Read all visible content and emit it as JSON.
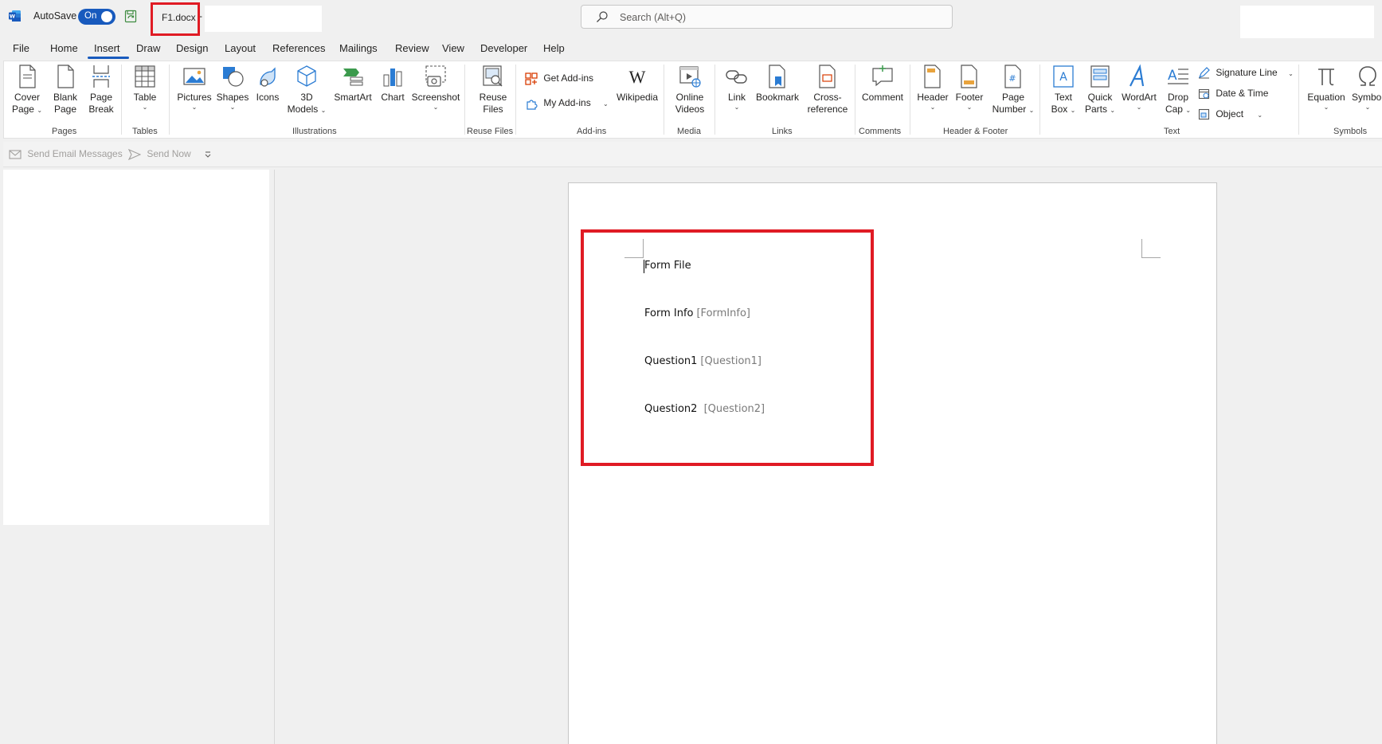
{
  "titlebar": {
    "autosave_label": "AutoSave",
    "autosave_state": "On",
    "filename": "F1.docx",
    "separator": "-",
    "search_placeholder": "Search (Alt+Q)"
  },
  "tabs": [
    "File",
    "Home",
    "Insert",
    "Draw",
    "Design",
    "Layout",
    "References",
    "Mailings",
    "Review",
    "View",
    "Developer",
    "Help"
  ],
  "active_tab": "Insert",
  "ribbon": {
    "pages": {
      "label": "Pages",
      "cover_1": "Cover",
      "cover_2": "Page",
      "blank_1": "Blank",
      "blank_2": "Page",
      "break_1": "Page",
      "break_2": "Break"
    },
    "tables": {
      "label": "Tables",
      "table": "Table"
    },
    "illustrations": {
      "label": "Illustrations",
      "pictures": "Pictures",
      "shapes": "Shapes",
      "icons": "Icons",
      "models_1": "3D",
      "models_2": "Models",
      "smartart": "SmartArt",
      "chart": "Chart",
      "screenshot": "Screenshot"
    },
    "reuse": {
      "label": "Reuse Files",
      "reuse_1": "Reuse",
      "reuse_2": "Files"
    },
    "addins": {
      "label": "Add-ins",
      "get": "Get Add-ins",
      "my": "My Add-ins",
      "wikipedia": "Wikipedia"
    },
    "media": {
      "label": "Media",
      "online_1": "Online",
      "online_2": "Videos"
    },
    "links": {
      "label": "Links",
      "link": "Link",
      "bookmark": "Bookmark",
      "cross_1": "Cross-",
      "cross_2": "reference"
    },
    "comments": {
      "label": "Comments",
      "comment": "Comment"
    },
    "headerfooter": {
      "label": "Header & Footer",
      "header": "Header",
      "footer": "Footer",
      "pagenum_1": "Page",
      "pagenum_2": "Number"
    },
    "text": {
      "label": "Text",
      "textbox_1": "Text",
      "textbox_2": "Box",
      "quick_1": "Quick",
      "quick_2": "Parts",
      "wordart": "WordArt",
      "drop_1": "Drop",
      "drop_2": "Cap",
      "signature": "Signature Line",
      "datetime": "Date & Time",
      "object": "Object"
    },
    "symbols": {
      "label": "Symbols",
      "equation": "Equation",
      "symbol": "Symbol"
    }
  },
  "quickbar": {
    "send_email": "Send Email Messages",
    "send_now": "Send Now"
  },
  "document": {
    "lines": [
      {
        "label": "Form File",
        "field": ""
      },
      {
        "label": "Form Info",
        "field": "[FormInfo]"
      },
      {
        "label": "Question1",
        "field": "[Question1]"
      },
      {
        "label": "Question2 ",
        "field": "[Question2]"
      }
    ]
  },
  "colors": {
    "accent": "#185abd",
    "highlight": "#e01b24"
  }
}
